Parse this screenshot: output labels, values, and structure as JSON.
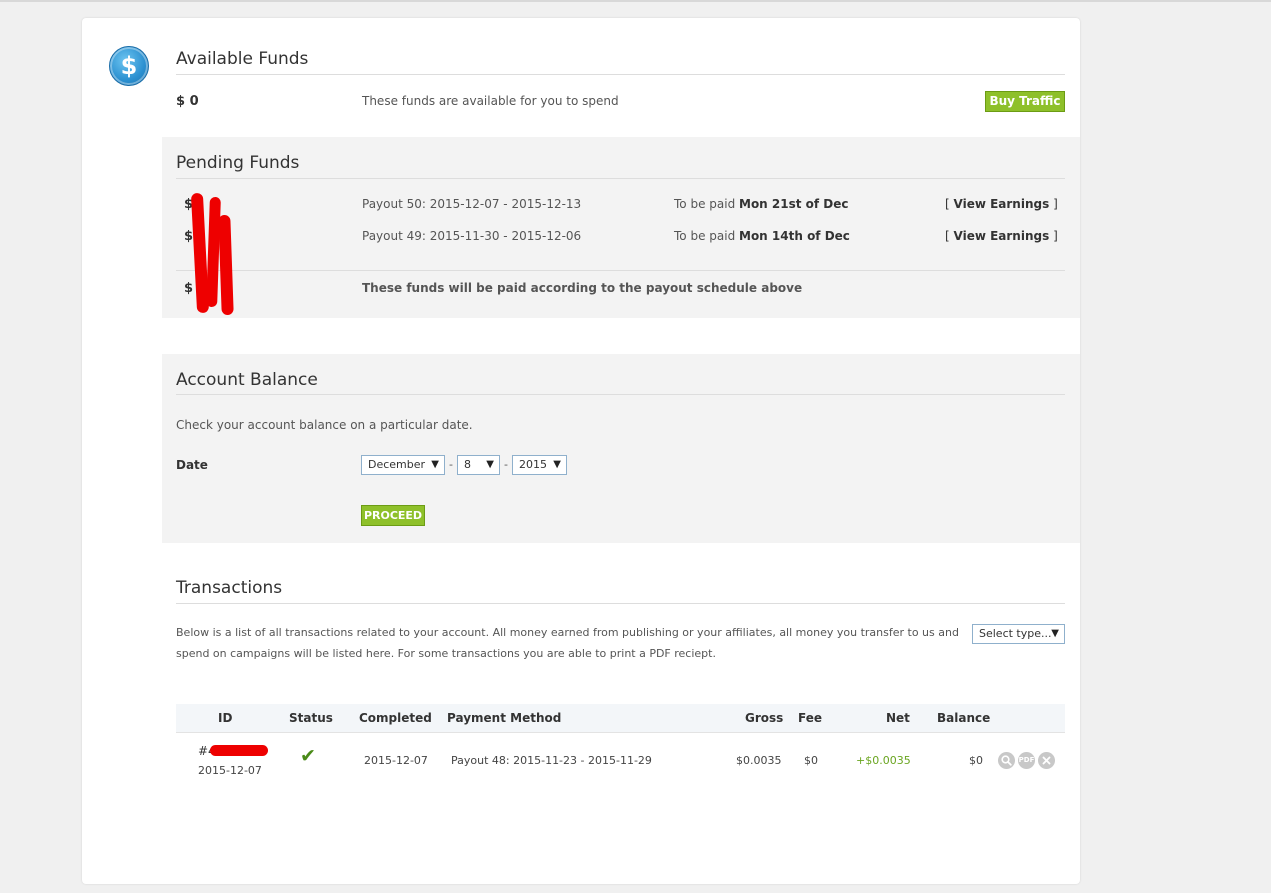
{
  "available_funds": {
    "title": "Available Funds",
    "amount": "$ 0",
    "description": "These funds are available for you to spend",
    "buy_button": "Buy Traffic"
  },
  "pending_funds": {
    "title": "Pending Funds",
    "rows": [
      {
        "amount": "$",
        "payout": "Payout 50: 2015-12-07 - 2015-12-13",
        "paid_prefix": "To be paid ",
        "paid_date": "Mon 21st of Dec",
        "link_open": "[ ",
        "link": "View Earnings",
        "link_close": " ]"
      },
      {
        "amount": "$",
        "payout": "Payout 49: 2015-11-30 - 2015-12-06",
        "paid_prefix": "To be paid ",
        "paid_date": "Mon 14th of Dec",
        "link_open": "[ ",
        "link": "View Earnings",
        "link_close": " ]"
      }
    ],
    "total_amount": "$",
    "total_note": "These funds will be paid according to the payout schedule above"
  },
  "account_balance": {
    "title": "Account Balance",
    "description": "Check your account balance on a particular date.",
    "date_label": "Date",
    "month": "December",
    "day": "8",
    "year": "2015",
    "separator": "-",
    "proceed_button": "PROCEED"
  },
  "transactions": {
    "title": "Transactions",
    "description_line1": "Below is a list of all transactions related to your account. All money earned from publishing or your affiliates, all money you transfer to us and",
    "description_line2": "spend on campaigns will be listed here. For some transactions you are able to print a PDF reciept.",
    "type_select": "Select type...",
    "columns": [
      "ID",
      "Status",
      "Completed",
      "Payment Method",
      "Gross",
      "Fee",
      "Net",
      "Balance"
    ],
    "rows": [
      {
        "id_prefix": "#4",
        "id_date": "2015-12-07",
        "completed": "2015-12-07",
        "payment_method": "Payout 48: 2015-11-23 - 2015-11-29",
        "gross": "$0.0035",
        "fee": "$0",
        "net": "+$0.0035",
        "balance": "$0"
      }
    ],
    "action_icons": [
      "search-icon",
      "pdf-icon",
      "close-icon"
    ],
    "pdf_label": "PDF"
  },
  "colors": {
    "accent_green": "#8ec02a",
    "net_positive": "#6aa520",
    "redaction": "#ee0000"
  }
}
